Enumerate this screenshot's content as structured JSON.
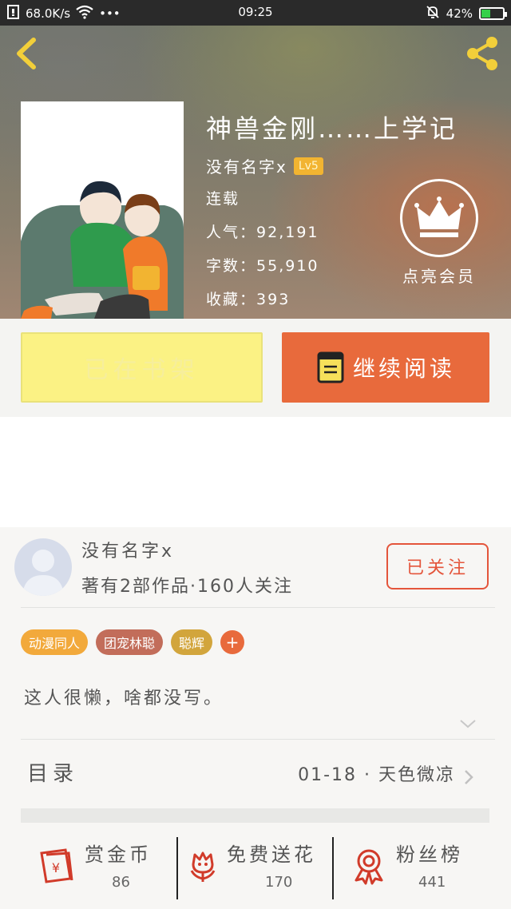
{
  "status_bar": {
    "net_speed": "68.0K/s",
    "menu_dots": "•••",
    "time": "09:25",
    "battery": "42%",
    "battery_level": 0.42
  },
  "book": {
    "title": "神兽金刚……上学记",
    "author": "没有名字x",
    "level": "Lv5",
    "status": "连载",
    "popularity_label": "人气：",
    "popularity": "92,191",
    "words_label": "字数：",
    "words": "55,910",
    "favorites_label": "收藏：",
    "favorites": "393"
  },
  "vip": {
    "label": "点亮会员"
  },
  "actions": {
    "shelf_label": "已在书架",
    "read_label": "继续阅读"
  },
  "author_block": {
    "name": "没有名字x",
    "stats": "著有2部作品·160人关注",
    "follow_label": "已关注",
    "tags": [
      {
        "label": "动漫同人",
        "color": "#f2a93b"
      },
      {
        "label": "团宠林聪",
        "color": "#c26d5a"
      },
      {
        "label": "聪辉",
        "color": "#d2a53c"
      }
    ],
    "add_tag": "+",
    "intro": "这人很懒，啥都没写。"
  },
  "toc": {
    "label": "目录",
    "latest": "01-18 · 天色微凉"
  },
  "bottom_stats": [
    {
      "label": "赏金币",
      "value": "86",
      "icon": "red-envelope-icon"
    },
    {
      "label": "免费送花",
      "value": "170",
      "icon": "flower-icon"
    },
    {
      "label": "粉丝榜",
      "value": "441",
      "icon": "medal-icon"
    }
  ],
  "colors": {
    "accent_orange": "#e86a3c",
    "shelf_yellow": "#fbf284",
    "follow_red": "#e4553b",
    "icon_red": "#d13b2a"
  }
}
